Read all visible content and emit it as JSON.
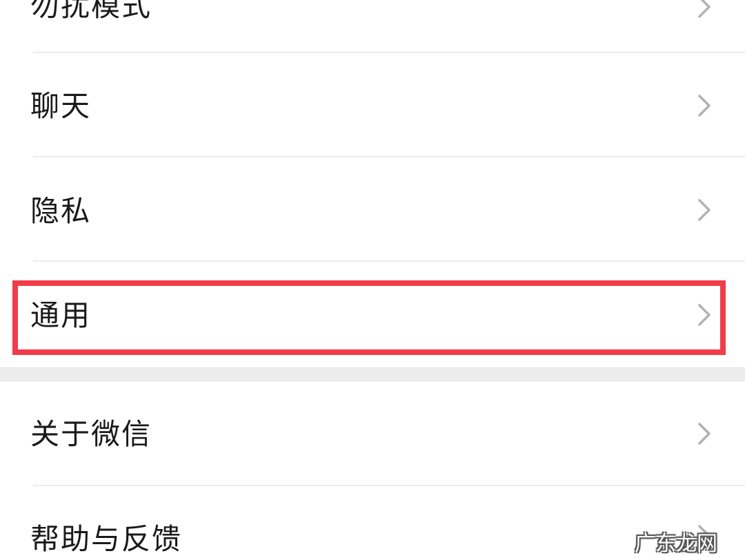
{
  "settings_list": {
    "items": [
      {
        "label": "勿扰模式"
      },
      {
        "label": "聊天"
      },
      {
        "label": "隐私"
      },
      {
        "label": "通用",
        "highlighted": true
      },
      {
        "label": "关于微信"
      },
      {
        "label": "帮助与反馈"
      }
    ]
  },
  "icons": {
    "chevron": "chevron-right-icon"
  },
  "colors": {
    "highlight": "#f23c49",
    "text": "#1a1a1a",
    "chevron": "#b2b2b2",
    "divider": "#ececec",
    "section_gap": "#ededed"
  },
  "watermark": {
    "text": "广东龙网"
  }
}
